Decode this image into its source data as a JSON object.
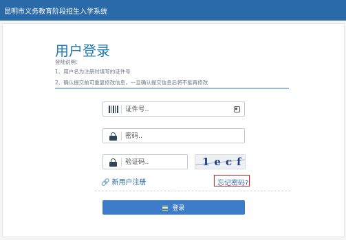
{
  "header": {
    "title": "昆明市义务教育阶段招生入学系统"
  },
  "login": {
    "title": "用户登录",
    "instructions_title": "登陆说明：",
    "instructions": [
      "1、用户名为注册时填写的证件号",
      "2、确认提交前可重复修改信息，一旦确认提交信息后将不能再修改"
    ],
    "id_placeholder": "证件号..",
    "password_placeholder": "密码..",
    "captcha_placeholder": "验证码..",
    "captcha_text": "1ecf",
    "register_label": "新用户注册",
    "forgot_label": "忘记密码?",
    "login_label": "登录"
  },
  "colors": {
    "header_bg": "#2b6aa8",
    "button_bg": "#3d7cc9",
    "highlight_border": "#e0161b"
  }
}
